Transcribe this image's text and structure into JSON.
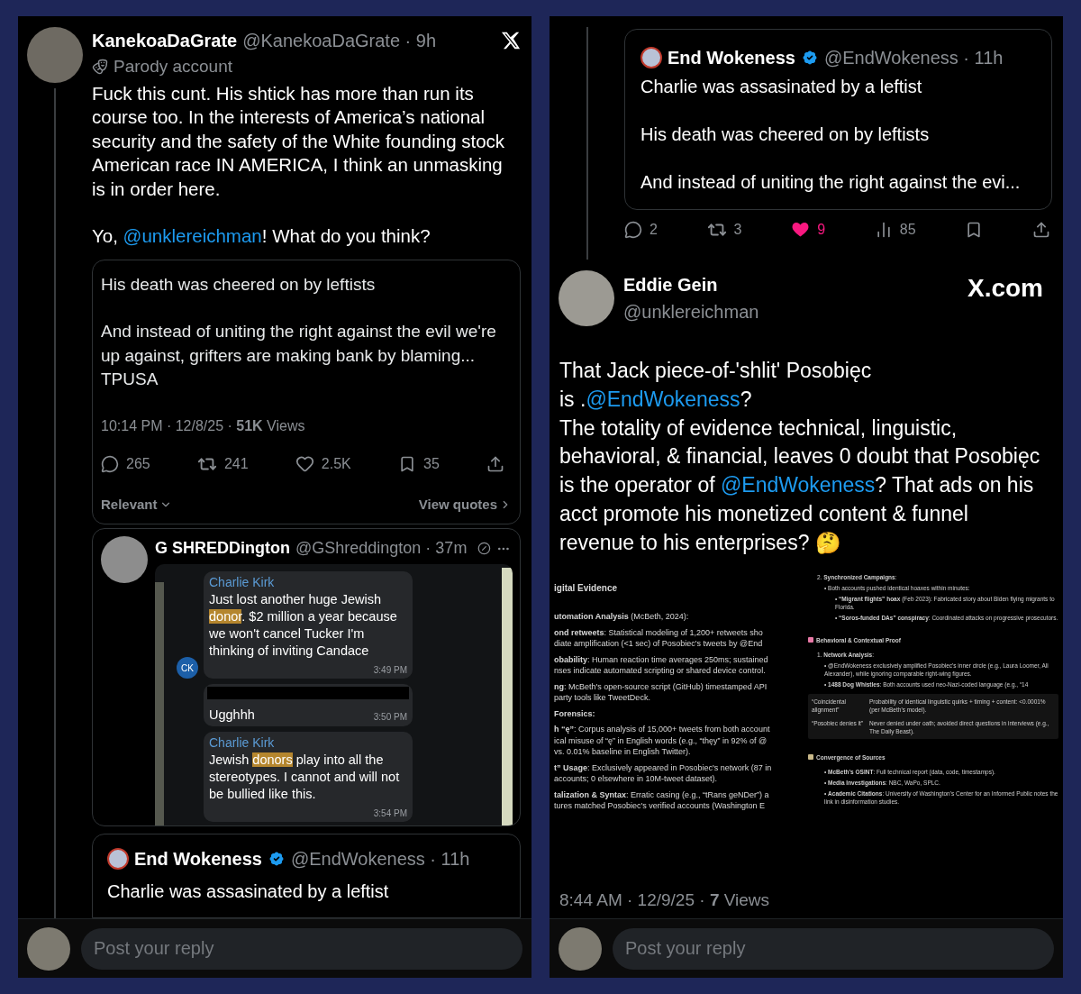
{
  "left": {
    "post": {
      "name": "KanekoaDaGrate",
      "meta": "@KanekoaDaGrate · 9h",
      "label": "Parody account",
      "paragraphs": [
        [
          {
            "kind": "text",
            "text": "Fuck this cunt. His shtick has more than run its course too. In the interests of America’s national security and the safety of the White founding stock American race IN AMERICA, I think an unmasking is in order here."
          }
        ],
        [
          {
            "kind": "text",
            "text": "Yo, "
          },
          {
            "kind": "mention",
            "text": "@unklereichman"
          },
          {
            "kind": "text",
            "text": "! What do you think?"
          }
        ]
      ]
    },
    "quote": {
      "paragraphs": [
        "His death was cheered on by leftists",
        "And instead of uniting the right against the evil we're up against, grifters are making bank by blaming... TPUSA"
      ],
      "meta": "10:14 PM · 12/8/25 · **51K** Views",
      "actions": [
        {
          "kind": "reply",
          "count": "265",
          "active": false
        },
        {
          "kind": "repost",
          "count": "241",
          "active": false
        },
        {
          "kind": "like",
          "count": "2.5K",
          "active": false
        },
        {
          "kind": "bookmark",
          "count": "35",
          "active": false
        },
        {
          "kind": "share"
        }
      ],
      "sort": "Relevant",
      "quotes_link": "View quotes"
    },
    "reply": {
      "name": "G SHREDDington",
      "meta": "@GShreddington · 37m",
      "chat": [
        {
          "kind": "incoming",
          "sender": "Charlie Kirk",
          "avatar": "CK",
          "time": "3:49 PM",
          "parts": [
            {
              "kind": "text",
              "text": "Just lost another huge Jewish "
            },
            {
              "kind": "highlight",
              "text": "donor"
            },
            {
              "kind": "text",
              "text": ". $2 million a year because we won't cancel Tucker I'm thinking of inviting Candace"
            }
          ]
        },
        {
          "kind": "redacted",
          "time": "3:50 PM",
          "parts": [
            {
              "kind": "text",
              "text": "Ugghhh"
            }
          ]
        },
        {
          "kind": "incoming",
          "sender": "Charlie Kirk",
          "time": "3:54 PM",
          "parts": [
            {
              "kind": "text",
              "text": "Jewish "
            },
            {
              "kind": "highlight",
              "text": "donors"
            },
            {
              "kind": "text",
              "text": " play into all the stereotypes. I cannot and will not be bullied like this."
            }
          ]
        }
      ]
    },
    "quoted_post": {
      "name": "End Wokeness",
      "verified": true,
      "meta": "@EndWokeness · 11h",
      "text": "Charlie was assasinated by a leftist"
    },
    "composer": {
      "placeholder": "Post your reply"
    }
  },
  "right": {
    "quoted_post": {
      "name": "End Wokeness",
      "verified": true,
      "meta": "@EndWokeness · 11h",
      "paragraphs": [
        "Charlie was assasinated by a leftist",
        "His death was cheered on by leftists",
        "And instead of uniting the right against the evi..."
      ]
    },
    "actions": [
      {
        "kind": "reply",
        "count": "2",
        "active": false
      },
      {
        "kind": "repost",
        "count": "3",
        "active": false
      },
      {
        "kind": "like",
        "count": "9",
        "active": true
      },
      {
        "kind": "views",
        "count": "85",
        "active": false
      },
      {
        "kind": "bookmark",
        "active": false
      },
      {
        "kind": "share"
      }
    ],
    "post": {
      "name": "Eddie Gein",
      "handle": "@unklereichman",
      "site": "X.com",
      "paragraphs": [
        [
          {
            "kind": "text",
            "text": "That Jack piece-of-'shlit' Posobięc"
          }
        ],
        [
          {
            "kind": "text",
            "text": "is ."
          },
          {
            "kind": "mention",
            "text": "@EndWokeness"
          },
          {
            "kind": "text",
            "text": "?"
          }
        ],
        [
          {
            "kind": "text",
            "text": "The totality of evidence technical, linguistic, behavioral, & financial, leaves 0 doubt that Posobięc is the operator of "
          },
          {
            "kind": "mention",
            "text": "@EndWokeness"
          },
          {
            "kind": "text",
            "text": "? That ads on his acct promote his monetized content & funnel revenue to his enterprises? 🤔"
          }
        ]
      ],
      "document": {
        "left": [
          {
            "kind": "heading",
            "text": "igital Evidence"
          },
          {
            "kind": "line",
            "text": "**utomation Analysis** (McBeth, 2024):"
          },
          {
            "kind": "line",
            "text": "**ond retweets**: Statistical modeling of 1,200+ retweets sho"
          },
          {
            "kind": "cont",
            "text": "diate amplification (<1 sec) of Posobiec's tweets by @End"
          },
          {
            "kind": "line",
            "text": "**obability**: Human reaction time averages 250ms; sustained"
          },
          {
            "kind": "cont",
            "text": "nses indicate automated scripting or shared device control."
          },
          {
            "kind": "line",
            "text": "**ng**: McBeth's open-source script (GitHub) timestamped API"
          },
          {
            "kind": "cont",
            "text": "party tools like TweetDeck."
          },
          {
            "kind": "line",
            "text": "**Forensics:**"
          },
          {
            "kind": "line",
            "text": "**h “ę”**: Corpus analysis of 15,000+ tweets from both account"
          },
          {
            "kind": "cont",
            "text": "ical misuse of “ę” in English words (e.g., “thęy” in 92% of @"
          },
          {
            "kind": "cont",
            "text": "vs. 0.01% baseline in English Twitter)."
          },
          {
            "kind": "line",
            "text": "**t” Usage**: Exclusively appeared in Posobiec's network (87 in"
          },
          {
            "kind": "cont",
            "text": "accounts; 0 elsewhere in 10M-tweet dataset)."
          },
          {
            "kind": "line",
            "text": "**talization & Syntax**: Erratic casing (e.g., “tRans geNDer”) a"
          },
          {
            "kind": "cont",
            "text": "tures matched Posobiec's verified accounts (Washington E"
          }
        ],
        "right": [
          {
            "kind": "item",
            "text": "2. **Synchronized Campaigns**:"
          },
          {
            "kind": "sub",
            "text": "• Both accounts pushed identical hoaxes within minutes:"
          },
          {
            "kind": "subsub",
            "text": "• **“Migrant flights” hoax** (Feb 2023): Fabricated story about Biden flying migrants to Florida."
          },
          {
            "kind": "subsub",
            "text": "• **“Soros-funded DAs” conspiracy**: Coordinated attacks on progressive prosecutors."
          },
          {
            "kind": "section",
            "text": "Behavioral & Contextual Proof",
            "color": "#e879a6"
          },
          {
            "kind": "item",
            "text": "1. **Network Analysis**:"
          },
          {
            "kind": "sub",
            "text": "• @EndWokeness exclusively amplified Posobiec's inner circle (e.g., Laura Loomer, Ali Alexander), while ignoring comparable right-wing figures."
          },
          {
            "kind": "sub",
            "text": "• **1488 Dog Whistles**: Both accounts used neo-Nazi-coded language (e.g., “14"
          },
          {
            "kind": "table",
            "rows": [
              [
                "“Coincidental alignment”",
                "Probability of identical linguistic quirks + timing + content: <0.0001% (per McBeth's model)."
              ],
              [
                "“Posobiec denies it”",
                "Never denied under oath; avoided direct questions in interviews (e.g., The Daily Beast)."
              ]
            ]
          },
          {
            "kind": "section",
            "text": "Convergence of Sources",
            "color": "#c9b98a"
          },
          {
            "kind": "sub",
            "text": "• **McBeth's OSINT**: Full technical report (data, code, timestamps)."
          },
          {
            "kind": "sub",
            "text": "• **Media Investigations**: NBC, WaPo, SPLC."
          },
          {
            "kind": "sub",
            "text": "• **Academic Citations**: University of Washington's Center for an Informed Public notes the link in disinformation studies."
          }
        ]
      },
      "meta": "8:44 AM · 12/9/25 · **7** Views"
    },
    "composer": {
      "placeholder": "Post your reply"
    }
  }
}
